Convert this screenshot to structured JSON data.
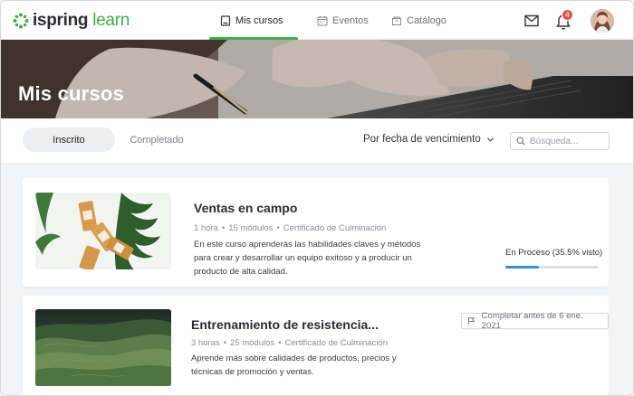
{
  "brand": {
    "name_part1": "ispring",
    "name_part2": "learn",
    "accent_color": "#3fae49"
  },
  "nav": {
    "items": [
      {
        "label": "Mis cursos",
        "icon": "book-icon",
        "active": true
      },
      {
        "label": "Eventos",
        "icon": "calendar-icon",
        "active": false
      },
      {
        "label": "Catálogo",
        "icon": "catalog-icon",
        "active": false
      }
    ],
    "notifications_count": "4"
  },
  "hero": {
    "title": "Mis cursos"
  },
  "toolbar": {
    "tabs": [
      {
        "label": "Inscrito",
        "selected": true
      },
      {
        "label": "Completado",
        "selected": false
      }
    ],
    "sort_label": "Por fecha de vencimiento",
    "search_placeholder": "Búsqueda..."
  },
  "courses": [
    {
      "title": "Ventas en campo",
      "duration": "1 hora",
      "modules": "15 módulos",
      "certificate": "Certificado de Culminación",
      "description": "En este curso aprenderás las habilidades claves y métodos para crear y desarrollar un equipo exitoso y a producir un producto de alta calidad.",
      "progress_label": "En Proceso (35.5% visto)",
      "progress_percent": 35.5
    },
    {
      "title": "Entrenamiento de resistencia...",
      "duration": "3 horas",
      "modules": "25 módulos",
      "certificate": "Certificado de Culminación",
      "description": "Aprende más sobre calidades de productos, precios y técnicas de promoción y ventas.",
      "deadline": "Completar antes de 6 ene. 2021"
    }
  ]
}
